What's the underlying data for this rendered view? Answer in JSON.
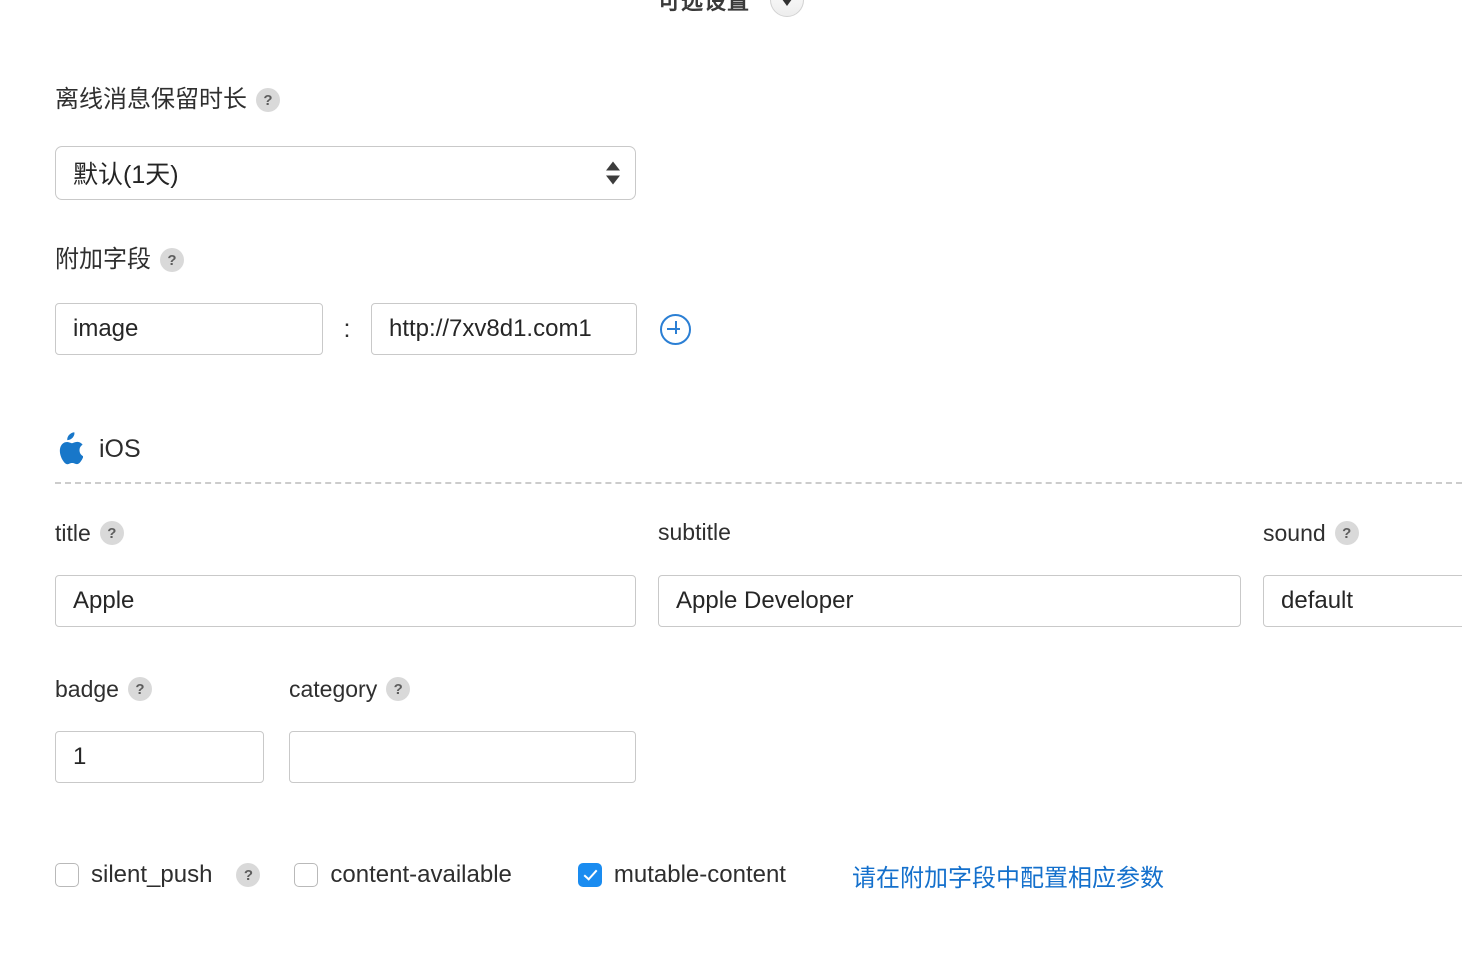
{
  "section_header": {
    "title": "可选设置",
    "toggle_icon": "chevron-down-icon"
  },
  "offline_retention": {
    "label": "离线消息保留时长",
    "help_icon": "?",
    "selected_value": "默认(1天)",
    "options": [
      "默认(1天)"
    ]
  },
  "extra_fields": {
    "label": "附加字段",
    "help_icon": "?",
    "separator": ":",
    "rows": [
      {
        "key": "image",
        "key_placeholder": "",
        "value": "http://7xv8d1.com1",
        "value_placeholder": ""
      }
    ],
    "add_icon": "plus-circle-icon"
  },
  "platform": {
    "name": "iOS",
    "icon": "apple-logo-icon"
  },
  "ios_fields": {
    "row1": [
      {
        "label": "title",
        "has_help": true,
        "help_icon": "?",
        "value": "Apple",
        "placeholder": ""
      },
      {
        "label": "subtitle",
        "has_help": false,
        "help_icon": "",
        "value": "Apple Developer",
        "placeholder": ""
      },
      {
        "label": "sound",
        "has_help": true,
        "help_icon": "?",
        "value": "default",
        "placeholder": ""
      }
    ],
    "row2": [
      {
        "label": "badge",
        "has_help": true,
        "help_icon": "?",
        "value": "1",
        "placeholder": ""
      },
      {
        "label": "category",
        "has_help": true,
        "help_icon": "?",
        "value": "",
        "placeholder": ""
      }
    ]
  },
  "ios_checkboxes": [
    {
      "label": "silent_push",
      "checked": false,
      "has_help": true,
      "help_icon": "?"
    },
    {
      "label": "content-available",
      "checked": false,
      "has_help": false,
      "help_icon": ""
    },
    {
      "label": "mutable-content",
      "checked": true,
      "has_help": false,
      "help_icon": ""
    }
  ],
  "hint": {
    "text": "请在附加字段中配置相应参数",
    "color": "#1470cc"
  },
  "colors": {
    "accent_blue": "#1a8cf0",
    "link_blue": "#1470cc",
    "apple_blue": "#1877c9",
    "input_border": "#c9c9c9",
    "help_badge": "#d9d9d9"
  }
}
